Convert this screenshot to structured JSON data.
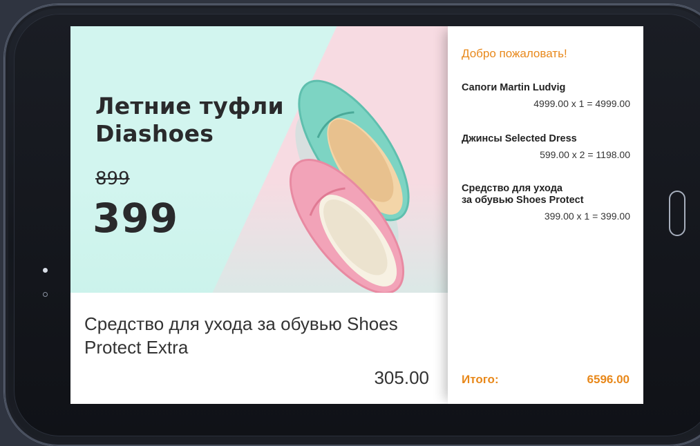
{
  "promo": {
    "title_line1": "Летние туфли",
    "title_line2": "Diashoes",
    "old_price": "899",
    "new_price": "399"
  },
  "product": {
    "name_line1": "Средство для ухода за обувью Shoes",
    "name_line2": "Protect Extra",
    "price": "305.00"
  },
  "cart": {
    "welcome": "Добро пожаловать!",
    "items": [
      {
        "name_line1": "Сапоги Martin Ludvig",
        "name_line2": "",
        "calc": "4999.00 x 1 = 4999.00"
      },
      {
        "name_line1": "Джинсы Selected Dress",
        "name_line2": "",
        "calc": "599.00 x 2 = 1198.00"
      },
      {
        "name_line1": "Средство для ухода",
        "name_line2": "за обувью Shoes Protect",
        "calc": "399.00 x 1 = 399.00"
      }
    ],
    "total_label": "Итого:",
    "total_value": "6596.00"
  },
  "colors": {
    "accent": "#e8881a",
    "promo_mint": "#d2f5ef",
    "promo_pink": "#f7dbe2",
    "bezel": "#1a1d24"
  },
  "icons": {
    "camera": "camera-dot-icon",
    "sensor": "sensor-dot-icon",
    "home": "home-button-icon"
  }
}
